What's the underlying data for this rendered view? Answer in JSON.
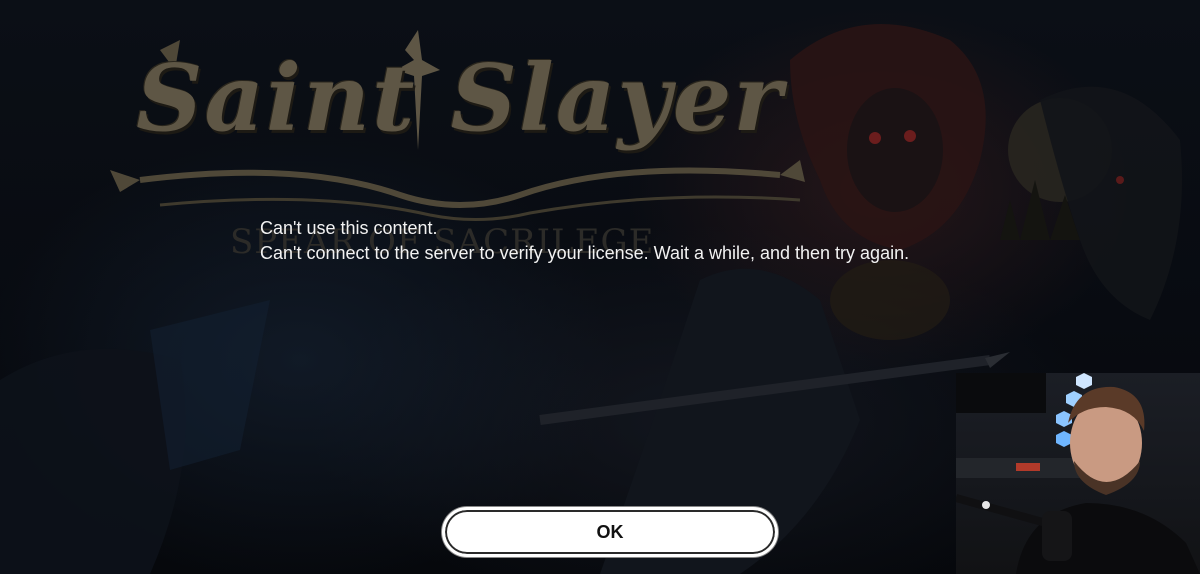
{
  "background": {
    "game_logo": {
      "title": "Saint Slayer",
      "subtitle": "SPEAR OF SACRILEGE",
      "color": "#5e5645"
    }
  },
  "dialog": {
    "message_line_1": "Can't use this content.",
    "message_line_2": "Can't connect to the server to verify your license. Wait a while, and then try again.",
    "ok_label": "OK"
  },
  "webcam_overlay": {
    "description_icon": "streamer-webcam-icon"
  },
  "colors": {
    "dialog_text": "#f2f2f2",
    "button_bg": "#ffffff",
    "button_text": "#111111",
    "backdrop": "#07090d"
  }
}
